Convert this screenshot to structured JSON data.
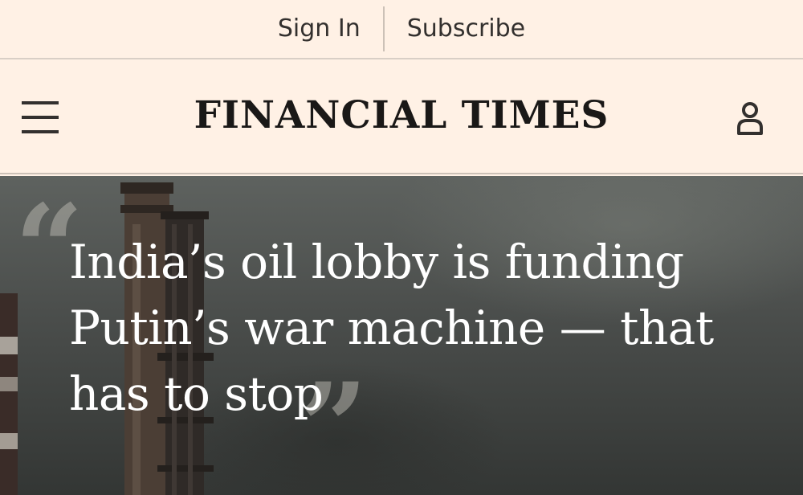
{
  "topbar": {
    "sign_in": "Sign In",
    "subscribe": "Subscribe"
  },
  "header": {
    "masthead": "FINANCIAL TIMES",
    "menu_icon": "hamburger-menu-icon",
    "account_icon": "user-account-icon"
  },
  "hero": {
    "headline": "India’s oil lobby is funding Putin’s war machine — that has to stop",
    "quote_open": "“",
    "quote_close": "”"
  },
  "colors": {
    "background": "#fff1e5",
    "text": "#33302e",
    "headline": "#ffffff"
  }
}
